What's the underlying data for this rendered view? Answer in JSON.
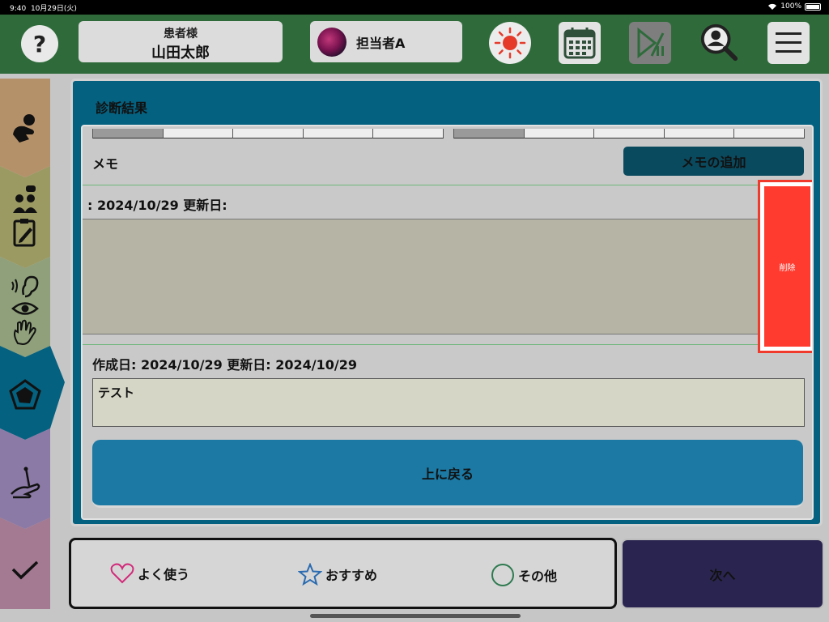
{
  "status": {
    "time": "9:40",
    "date": "10月29日(火)",
    "battery": "100%"
  },
  "header": {
    "help_label": "?",
    "patient_label": "患者様",
    "patient_name": "山田太郎",
    "staff_name": "担当者A"
  },
  "colors": {
    "header_bg": "#2f6b3a",
    "panel_bg": "#046180",
    "delete_red": "#ff3b2f",
    "back_button": "#1b79a4",
    "next_button": "#2a2550"
  },
  "sidebar": {
    "tabs": [
      {
        "icon": "hand-transfer-icon",
        "color": "#b5916a"
      },
      {
        "icon": "people-clipboard-icon",
        "color": "#9c9a63"
      },
      {
        "icon": "senses-icon",
        "color": "#8fa07a"
      },
      {
        "icon": "pentagon-chart-icon",
        "color": "#046180",
        "active": true
      },
      {
        "icon": "acupuncture-icon",
        "color": "#8b7aa6"
      },
      {
        "icon": "check-icon",
        "color": "#a37a92"
      }
    ]
  },
  "panel": {
    "title": "診断結果",
    "memo_label": "メモ",
    "add_memo_label": "メモの追加",
    "memos": [
      {
        "dates": ": 2024/10/29  更新日:",
        "text": ""
      },
      {
        "dates": "作成日: 2024/10/29  更新日:  2024/10/29",
        "text": "テスト"
      }
    ],
    "delete_label": "削除",
    "back_label": "上に戻る"
  },
  "footer": {
    "favorites_label": "よく使う",
    "recommended_label": "おすすめ",
    "other_label": "その他",
    "next_label": "次へ"
  }
}
